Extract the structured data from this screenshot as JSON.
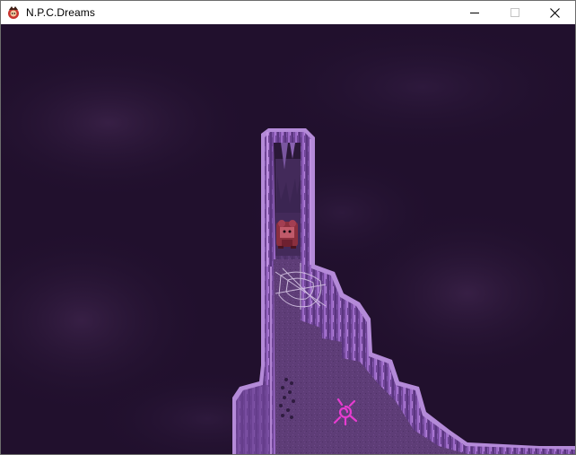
{
  "window": {
    "title": "N.P.C.Dreams",
    "controls": [
      "minimize",
      "maximize",
      "close"
    ]
  },
  "scene": {
    "icons": [
      "player-character-sprite",
      "spider-web-icon",
      "pink-spiral-sigil-icon",
      "rubble-pile"
    ],
    "colors": {
      "fog": "#24112f",
      "fog_light": "#3a2148",
      "cliff_light": "#9a68c6",
      "cliff_mid": "#7a4ea4",
      "cliff_dark": "#4d2a6d",
      "floor": "#5e3d77",
      "sigil": "#e63cd0"
    }
  }
}
